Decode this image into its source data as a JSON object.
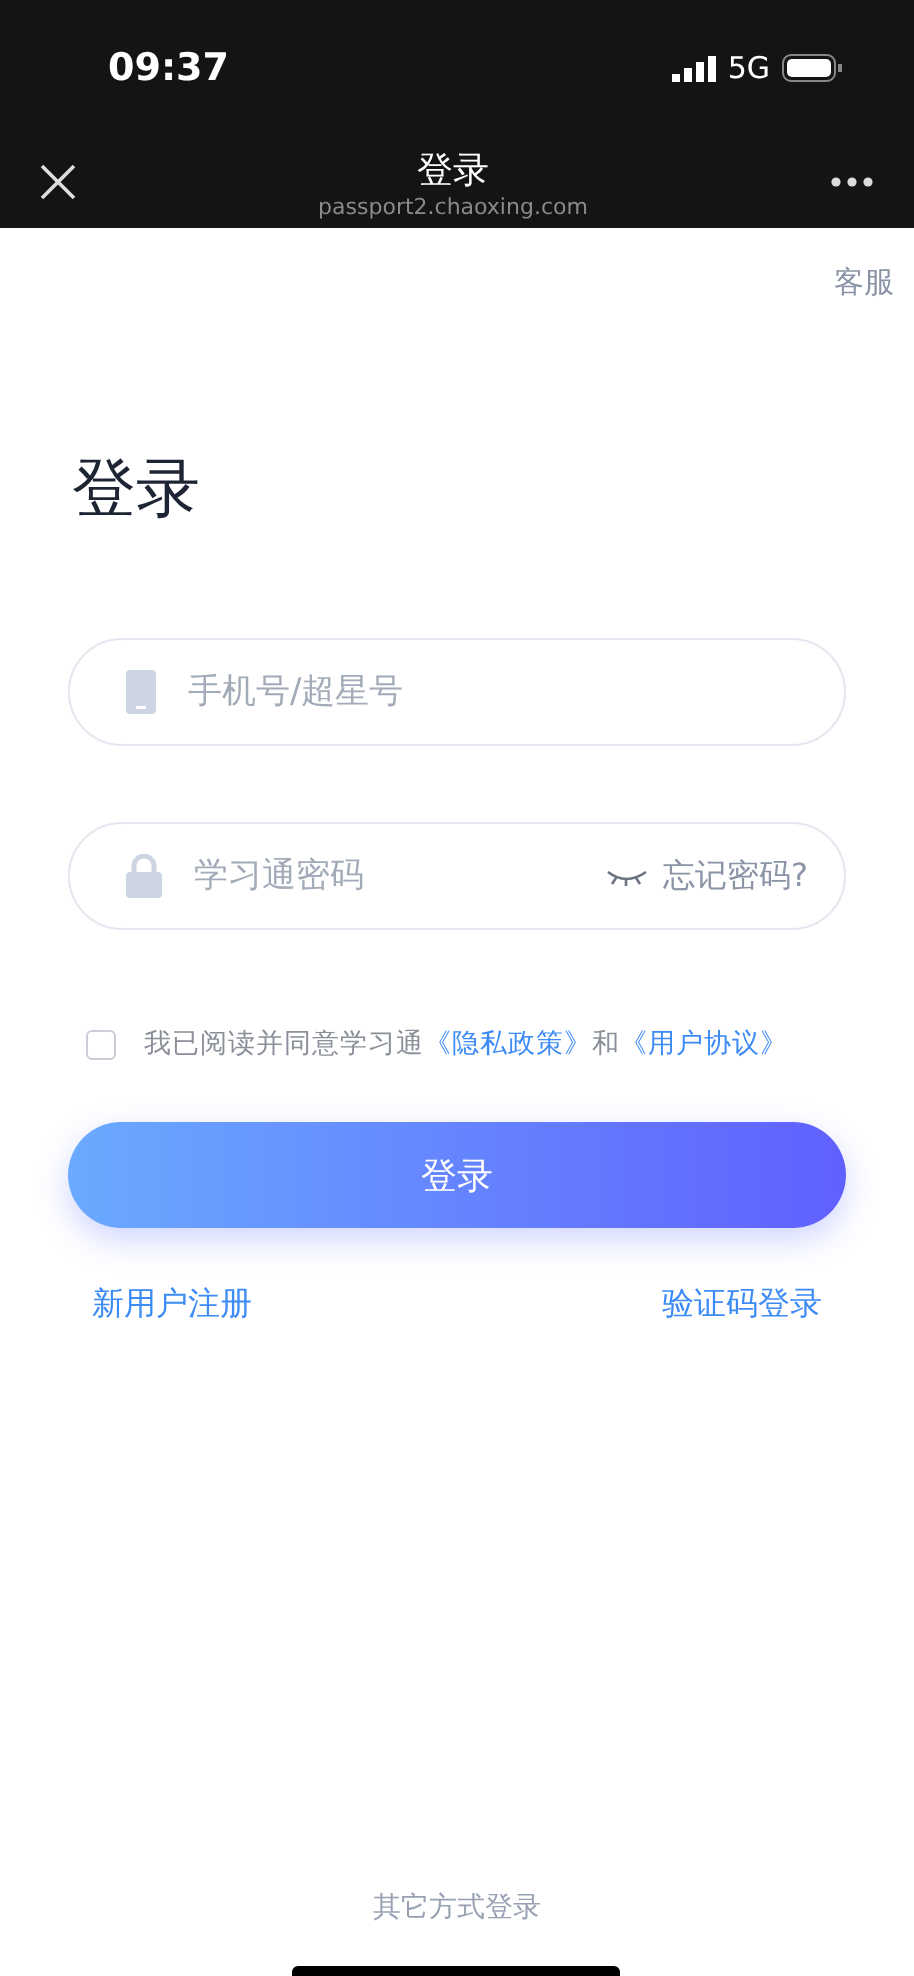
{
  "status_bar": {
    "time": "09:37",
    "network": "5G"
  },
  "nav": {
    "title": "登录",
    "url": "passport2.chaoxing.com"
  },
  "service": "客服",
  "heading": "登录",
  "phone_field": {
    "placeholder": "手机号/超星号"
  },
  "password_field": {
    "placeholder": "学习通密码",
    "forgot": "忘记密码?"
  },
  "agreement": {
    "checked": false,
    "text": "我已阅读并同意学习通",
    "privacy": "《隐私政策》",
    "and": "和",
    "terms": "《用户协议》"
  },
  "login_button": "登录",
  "register": "新用户注册",
  "sms_login": "验证码登录",
  "other_login": "其它方式登录"
}
